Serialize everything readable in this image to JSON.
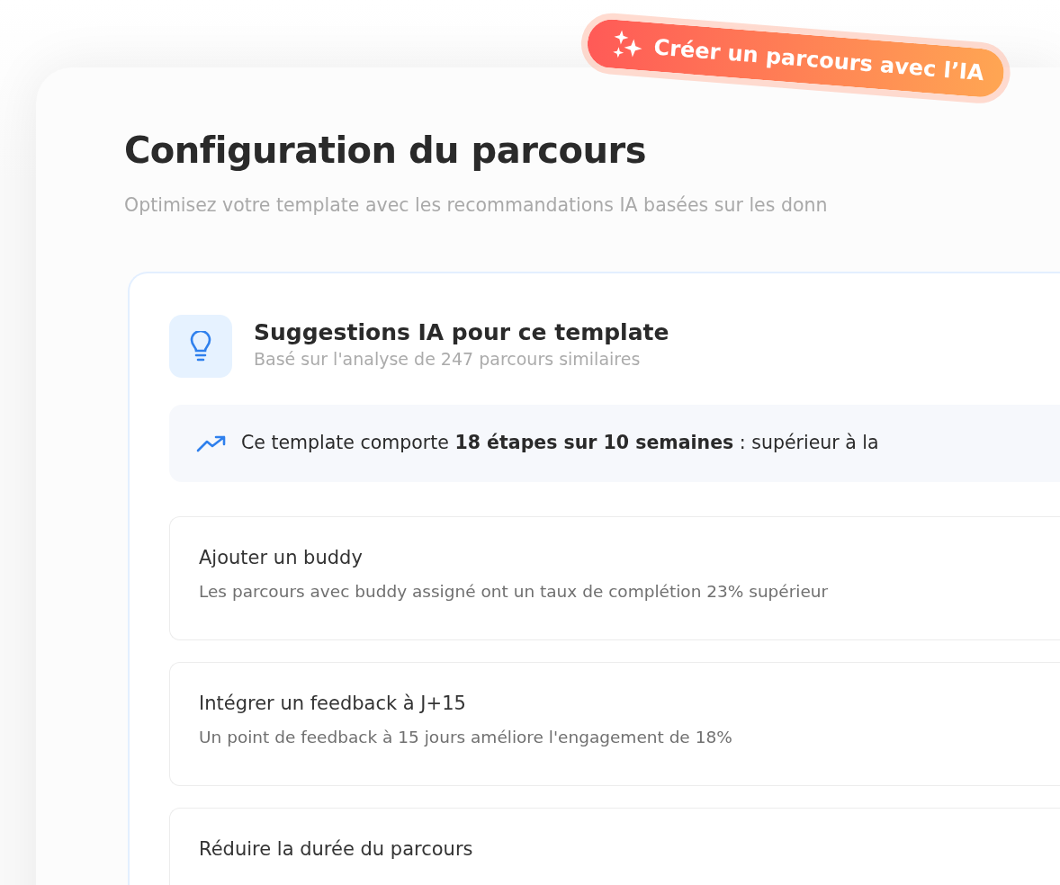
{
  "ai_button": {
    "label": "Créer un parcours avec l’IA"
  },
  "header": {
    "title": "Configuration du parcours",
    "subtitle": "Optimisez votre template avec les recommandations IA basées sur les donn"
  },
  "suggestions": {
    "title": "Suggestions IA pour ce template",
    "subtitle": "Basé sur l'analyse de 247 parcours similaires",
    "insight": "Ce template comporte **18 étapes sur 10 semaines** : supérieur à la",
    "items": [
      {
        "title": "Ajouter un buddy",
        "description": "Les parcours avec buddy assigné ont un taux de complétion 23% supérieur"
      },
      {
        "title": "Intégrer un feedback à J+15",
        "description": "Un point de feedback à 15 jours améliore l'engagement de 18%"
      },
      {
        "title": "Réduire la durée du parcours"
      }
    ]
  }
}
